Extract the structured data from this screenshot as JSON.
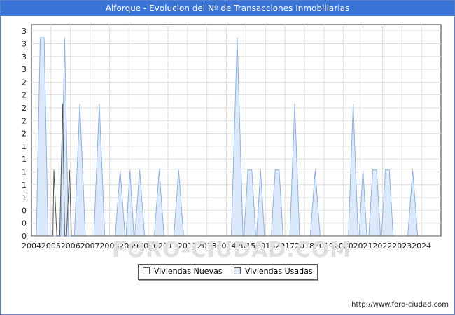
{
  "title": "Alforque - Evolucion del Nº de Transacciones Inmobiliarias",
  "footer": "http://www.foro-ciudad.com",
  "watermark": "FORO-CIUDAD.COM",
  "legend": [
    {
      "label": "Viviendas Nuevas",
      "color": "#ffffff"
    },
    {
      "label": "Viviendas Usadas",
      "color": "#dce9fb"
    }
  ],
  "chart_data": {
    "type": "area",
    "xlabel": "",
    "ylabel": "",
    "x_range": [
      2004,
      2025
    ],
    "y_range": [
      0,
      3.2
    ],
    "x_tick_labels": [
      "2004",
      "2005",
      "2006",
      "2007",
      "2008",
      "2009",
      "2010",
      "2011",
      "2012",
      "2013",
      "2014",
      "2015",
      "2016",
      "2017",
      "2018",
      "2019",
      "2020",
      "2021",
      "2022",
      "2023",
      "2024"
    ],
    "y_tick_labels": [
      "0",
      "0",
      "0",
      "1",
      "1",
      "1",
      "1",
      "1",
      "2",
      "2",
      "2",
      "2",
      "2",
      "3",
      "3",
      "3",
      "3"
    ],
    "grid": true,
    "legend_position": "bottom",
    "colors": {
      "usadas_fill": "#dce9fb",
      "usadas_line": "#8fb0de",
      "nuevas_line": "#555555"
    },
    "series": [
      {
        "name": "Viviendas Nuevas",
        "points": [
          [
            2004.0,
            0
          ],
          [
            2005.1,
            0
          ],
          [
            2005.15,
            1
          ],
          [
            2005.3,
            0
          ],
          [
            2005.45,
            0
          ],
          [
            2005.6,
            2
          ],
          [
            2005.7,
            0
          ],
          [
            2005.8,
            0
          ],
          [
            2005.95,
            1
          ],
          [
            2006.05,
            0
          ],
          [
            2025.0,
            0
          ]
        ]
      },
      {
        "name": "Viviendas Usadas",
        "points": [
          [
            2004.0,
            0
          ],
          [
            2004.25,
            0
          ],
          [
            2004.45,
            3
          ],
          [
            2004.65,
            3
          ],
          [
            2004.85,
            0
          ],
          [
            2005.5,
            0
          ],
          [
            2005.7,
            3
          ],
          [
            2005.9,
            0
          ],
          [
            2006.2,
            0
          ],
          [
            2006.48,
            2
          ],
          [
            2006.76,
            0
          ],
          [
            2007.2,
            0
          ],
          [
            2007.48,
            2
          ],
          [
            2007.76,
            0
          ],
          [
            2008.3,
            0
          ],
          [
            2008.55,
            1
          ],
          [
            2008.8,
            0
          ],
          [
            2008.85,
            0
          ],
          [
            2009.05,
            1
          ],
          [
            2009.25,
            0
          ],
          [
            2009.3,
            0
          ],
          [
            2009.55,
            1
          ],
          [
            2009.8,
            0
          ],
          [
            2010.3,
            0
          ],
          [
            2010.55,
            1
          ],
          [
            2010.8,
            0
          ],
          [
            2011.3,
            0
          ],
          [
            2011.55,
            1
          ],
          [
            2011.8,
            0
          ],
          [
            2014.25,
            0
          ],
          [
            2014.55,
            3
          ],
          [
            2014.85,
            0
          ],
          [
            2014.9,
            0
          ],
          [
            2015.1,
            1
          ],
          [
            2015.3,
            1
          ],
          [
            2015.5,
            0
          ],
          [
            2015.55,
            0
          ],
          [
            2015.75,
            1
          ],
          [
            2015.95,
            0
          ],
          [
            2016.3,
            0
          ],
          [
            2016.5,
            1
          ],
          [
            2016.7,
            1
          ],
          [
            2016.9,
            0
          ],
          [
            2017.25,
            0
          ],
          [
            2017.5,
            2
          ],
          [
            2017.75,
            0
          ],
          [
            2018.3,
            0
          ],
          [
            2018.55,
            1
          ],
          [
            2018.8,
            0
          ],
          [
            2020.25,
            0
          ],
          [
            2020.5,
            2
          ],
          [
            2020.75,
            0
          ],
          [
            2020.8,
            0
          ],
          [
            2021.0,
            1
          ],
          [
            2021.2,
            0
          ],
          [
            2021.3,
            0
          ],
          [
            2021.5,
            1
          ],
          [
            2021.7,
            1
          ],
          [
            2021.9,
            0
          ],
          [
            2021.95,
            0
          ],
          [
            2022.15,
            1
          ],
          [
            2022.35,
            1
          ],
          [
            2022.55,
            0
          ],
          [
            2023.3,
            0
          ],
          [
            2023.55,
            1
          ],
          [
            2023.8,
            0
          ],
          [
            2025.0,
            0
          ]
        ]
      }
    ]
  }
}
